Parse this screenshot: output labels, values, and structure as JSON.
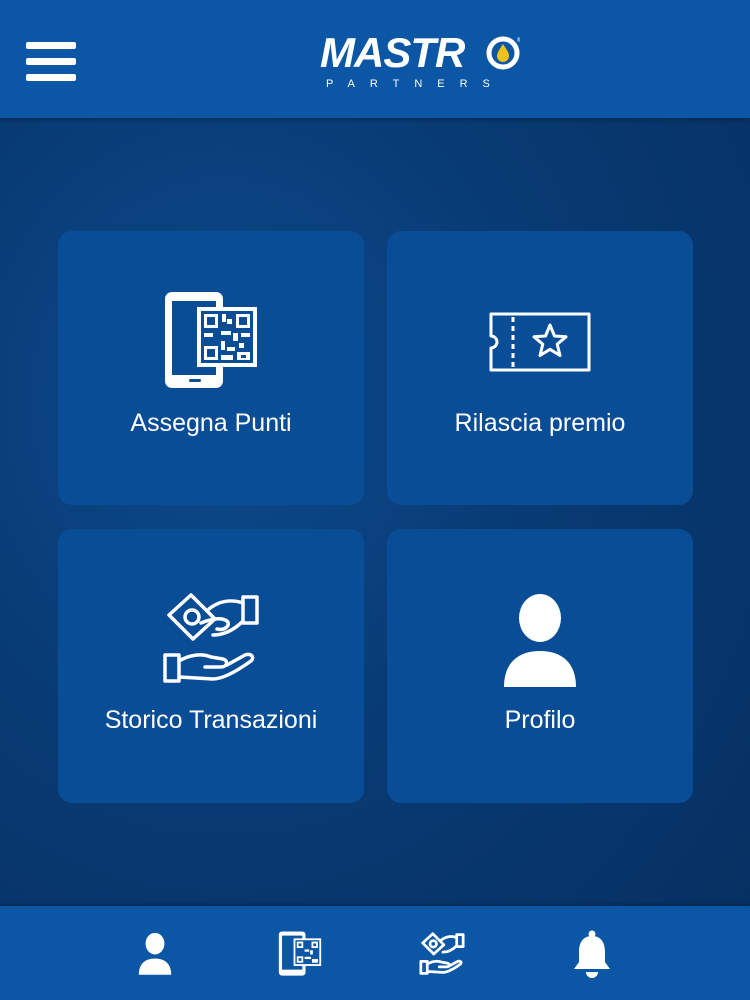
{
  "header": {
    "logo_main": "MASTR",
    "logo_sub": "PARTNERS"
  },
  "tiles": [
    {
      "label": "Assegna Punti",
      "icon": "phone-qr-icon"
    },
    {
      "label": "Rilascia premio",
      "icon": "ticket-star-icon"
    },
    {
      "label": "Storico Transazioni",
      "icon": "money-exchange-icon"
    },
    {
      "label": "Profilo",
      "icon": "user-icon"
    }
  ],
  "bottom_nav": [
    {
      "icon": "user-icon"
    },
    {
      "icon": "phone-qr-icon"
    },
    {
      "icon": "money-exchange-icon"
    },
    {
      "icon": "bell-icon"
    }
  ],
  "colors": {
    "header_bg": "#0b56a5",
    "page_bg": "#083a73",
    "tile_bg": "#0a4d97",
    "text": "#ffffff",
    "logo_drop": "#f2c21b"
  }
}
